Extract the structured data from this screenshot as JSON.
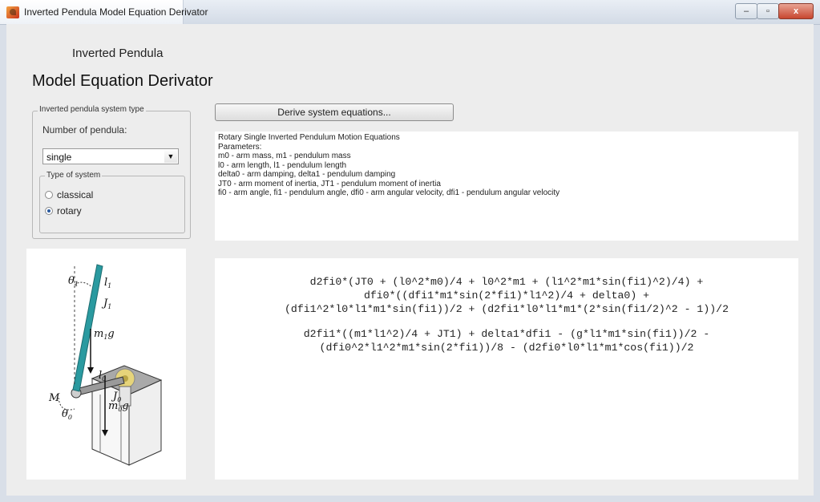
{
  "window": {
    "title": "Inverted Pendula Model Equation Derivator",
    "buttons": {
      "minimize": "–",
      "maximize": "▫",
      "close": "x"
    }
  },
  "header": {
    "line1": "Inverted Pendula",
    "line2": "Model Equation Derivator"
  },
  "system_group": {
    "legend": "Inverted pendula system type",
    "number_label": "Number of pendula:",
    "number_select": {
      "value": "single"
    },
    "type_group": {
      "legend": "Type of system",
      "options": [
        {
          "label": "classical",
          "selected": false
        },
        {
          "label": "rotary",
          "selected": true
        }
      ]
    }
  },
  "derive_button": {
    "label": "Derive system equations..."
  },
  "description": {
    "lines": [
      "Rotary Single Inverted Pendulum Motion Equations",
      "Parameters:",
      "m0 - arm mass, m1 - pendulum mass",
      "l0 - arm length, l1 - pendulum length",
      "delta0 - arm damping, delta1 - pendulum damping",
      "JT0 - arm moment of inertia, JT1 - pendulum moment of inertia",
      "fi0 - arm angle, fi1 - pendulum angle, dfi0 - arm angular velocity, dfi1 - pendulum angular velocity"
    ]
  },
  "diagram": {
    "labels": {
      "theta1": "θ",
      "l1": "l",
      "J1": "J",
      "m1g": "m",
      "l0": "l",
      "J0": "J",
      "M": "M",
      "theta0": "θ",
      "m0g": "m"
    },
    "subscripts": {
      "one": "1",
      "zero": "0"
    },
    "g": "g"
  },
  "equations": {
    "eq1": [
      "d2fi0*(JT0 + (l0^2*m0)/4 + l0^2*m1 + (l1^2*m1*sin(fi1)^2)/4) +",
      "dfi0*((dfi1*m1*sin(2*fi1)*l1^2)/4 + delta0) +",
      "(dfi1^2*l0*l1*m1*sin(fi1))/2 + (d2fi1*l0*l1*m1*(2*sin(fi1/2)^2 - 1))/2"
    ],
    "eq2": [
      "d2fi1*((m1*l1^2)/4 + JT1) + delta1*dfi1 - (g*l1*m1*sin(fi1))/2 -",
      "(dfi0^2*l1^2*m1*sin(2*fi1))/8 - (d2fi0*l0*l1*m1*cos(fi1))/2"
    ]
  },
  "colors": {
    "pendulum": "#2a9aa0",
    "arm": "#9a9a9a",
    "gear": "#e6d47a"
  }
}
